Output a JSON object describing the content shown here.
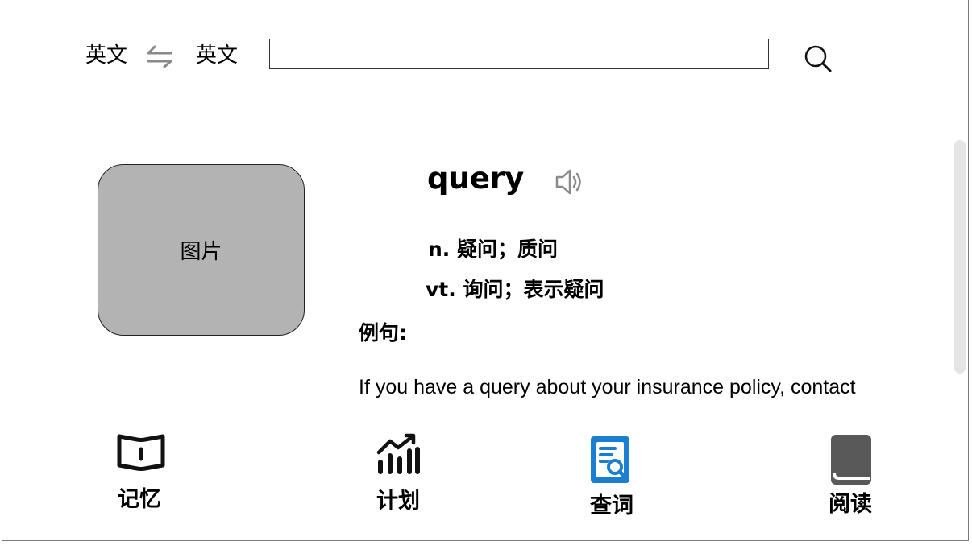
{
  "header": {
    "source_lang": "英文",
    "target_lang": "英文",
    "swap_icon": "swap-arrows-icon",
    "search": {
      "value": "",
      "placeholder": ""
    },
    "search_icon": "search-icon"
  },
  "entry": {
    "picture_label": "图片",
    "word": "query",
    "speaker_icon": "speaker-icon",
    "definitions": [
      "n. 疑问；质问",
      "vt. 询问；表示疑问"
    ],
    "example_label": "例句:",
    "example_text": "If you have a query about your insurance policy, contact"
  },
  "bottom_nav": {
    "items": [
      {
        "label": "记忆",
        "icon": "open-book-icon",
        "active": false
      },
      {
        "label": "计划",
        "icon": "bar-chart-icon",
        "active": false
      },
      {
        "label": "查词",
        "icon": "document-search-icon",
        "active": true
      },
      {
        "label": "阅读",
        "icon": "book-icon",
        "active": false
      }
    ]
  },
  "colors": {
    "active_icon": "#1a7fd1",
    "inactive_icon": "#000000",
    "picture_bg": "#b3b3b3",
    "icon_gray": "#888888"
  }
}
